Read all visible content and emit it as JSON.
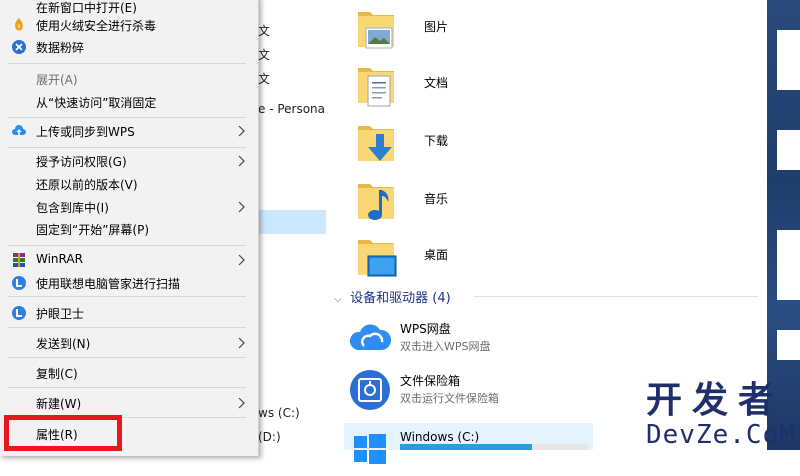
{
  "context_menu": {
    "items": [
      {
        "label": "在新窗口中打开(E)",
        "icon": "none"
      },
      {
        "label": "使用火绒安全进行杀毒",
        "icon": "huorong-shield-icon"
      },
      {
        "label": "数据粉碎",
        "icon": "shredder-icon"
      },
      {
        "label": "展开(A)",
        "disabled": true
      },
      {
        "label": "从“快速访问”取消固定"
      },
      {
        "label": "上传或同步到WPS",
        "icon": "cloud-upload-icon",
        "submenu": true
      },
      {
        "label": "授予访问权限(G)",
        "submenu": true
      },
      {
        "label": "还原以前的版本(V)"
      },
      {
        "label": "包含到库中(I)",
        "submenu": true
      },
      {
        "label": "固定到“开始”屏幕(P)"
      },
      {
        "label": "WinRAR",
        "icon": "winrar-icon",
        "submenu": true
      },
      {
        "label": "使用联想电脑管家进行扫描",
        "icon": "lenovo-icon"
      },
      {
        "label": "护眼卫士",
        "icon": "lenovo-icon"
      },
      {
        "label": "发送到(N)",
        "submenu": true
      },
      {
        "label": "复制(C)"
      },
      {
        "label": "新建(W)",
        "submenu": true
      },
      {
        "label": "属性(R)"
      }
    ],
    "highlight_color": "#e8161e"
  },
  "nav_pane": {
    "rows": [
      "文",
      "文",
      "文",
      "e - Personal",
      "ws (C:)",
      "(D:)"
    ]
  },
  "folders": [
    {
      "label": "图片",
      "icon": "pictures-folder-icon"
    },
    {
      "label": "文档",
      "icon": "documents-folder-icon"
    },
    {
      "label": "下载",
      "icon": "downloads-folder-icon"
    },
    {
      "label": "音乐",
      "icon": "music-folder-icon"
    },
    {
      "label": "桌面",
      "icon": "desktop-folder-icon"
    }
  ],
  "devices_section": {
    "title": "设备和驱动器 (4)"
  },
  "drives": [
    {
      "name": "WPS网盘",
      "desc": "双击进入WPS网盘",
      "icon": "wps-cloud-icon"
    },
    {
      "name": "文件保险箱",
      "desc": "双击运行文件保险箱",
      "icon": "safe-box-icon"
    },
    {
      "name": "Windows (C:)",
      "icon": "windows-drive-icon",
      "usage_fraction": 0.7
    }
  ],
  "watermark": {
    "line1": "开发者",
    "line2": "DevZe.CoM"
  },
  "colors": {
    "accent": "#26a0da",
    "folder": "#f8d775",
    "selection": "#cce8ff"
  }
}
